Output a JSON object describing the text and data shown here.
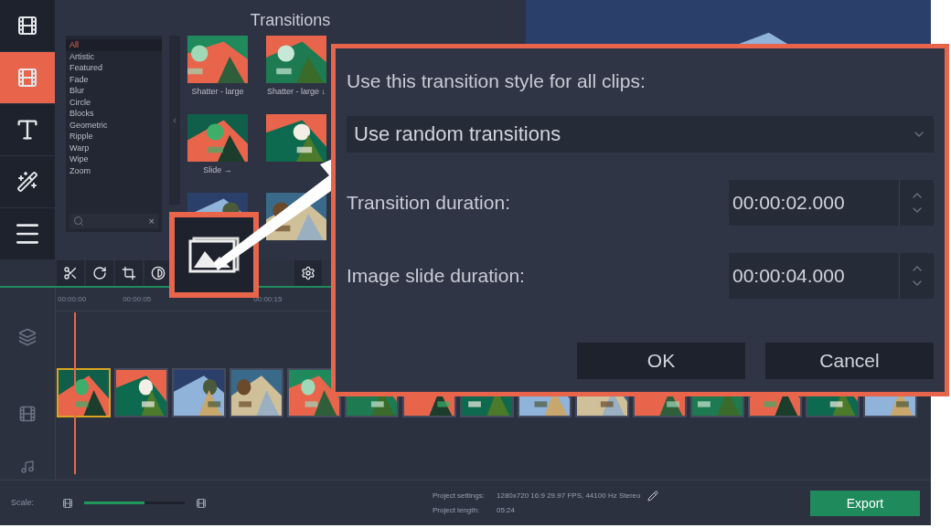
{
  "sidebar": {
    "items": [
      {
        "kind": "media",
        "selected": false
      },
      {
        "kind": "transitions",
        "selected": true
      },
      {
        "kind": "titles",
        "selected": false
      },
      {
        "kind": "filters",
        "selected": false
      },
      {
        "kind": "more",
        "selected": false
      }
    ]
  },
  "transitions_panel": {
    "title": "Transitions",
    "categories": [
      {
        "label": "All",
        "selected": true
      },
      {
        "label": "Artistic",
        "selected": false
      },
      {
        "label": "Featured",
        "selected": false
      },
      {
        "label": "Fade",
        "selected": false
      },
      {
        "label": "Blur",
        "selected": false
      },
      {
        "label": "Circle",
        "selected": false
      },
      {
        "label": "Blocks",
        "selected": false
      },
      {
        "label": "Geometric",
        "selected": false
      },
      {
        "label": "Ripple",
        "selected": false
      },
      {
        "label": "Warp",
        "selected": false
      },
      {
        "label": "Wipe",
        "selected": false
      },
      {
        "label": "Zoom",
        "selected": false
      }
    ],
    "search_clear": "×",
    "collapse": "‹",
    "tiles": [
      {
        "kind": "picture",
        "label": "Shatter - large"
      },
      {
        "kind": "picture",
        "label": "Shatter - large ↓"
      },
      {
        "kind": "picture",
        "label": "Slide →"
      },
      {
        "kind": "picture"
      },
      {
        "kind": "picture"
      },
      {
        "kind": "picture"
      }
    ]
  },
  "timeline": {
    "ruler": [
      "00:00:00",
      "00:00:05",
      "00:00:15"
    ],
    "clips": [
      {
        "selected": true
      },
      {
        "selected": false
      },
      {
        "selected": false
      },
      {
        "selected": false
      },
      {
        "selected": false
      },
      {
        "selected": false
      },
      {
        "selected": false
      },
      {
        "selected": false
      },
      {
        "selected": false
      },
      {
        "selected": false
      },
      {
        "selected": false
      },
      {
        "selected": false
      },
      {
        "selected": false
      },
      {
        "selected": false
      },
      {
        "selected": false
      }
    ]
  },
  "footer": {
    "scale_label": "Scale:",
    "scale": {
      "level": 0.6
    },
    "settings_label": "Project settings:",
    "settings_value": "1280x720 16:9 29.97 FPS, 44100 Hz Stereo",
    "length_label": "Project length:",
    "length_value": "05:24",
    "export": "Export"
  },
  "dialog": {
    "style_label": "Use this transition style for all clips:",
    "style_value": "Use random transitions",
    "fields": [
      {
        "label": "Transition duration:",
        "value": "00:00:02.000"
      },
      {
        "label": "Image slide duration:",
        "value": "00:00:04.000"
      }
    ],
    "buttons": [
      "OK",
      "Cancel"
    ]
  }
}
